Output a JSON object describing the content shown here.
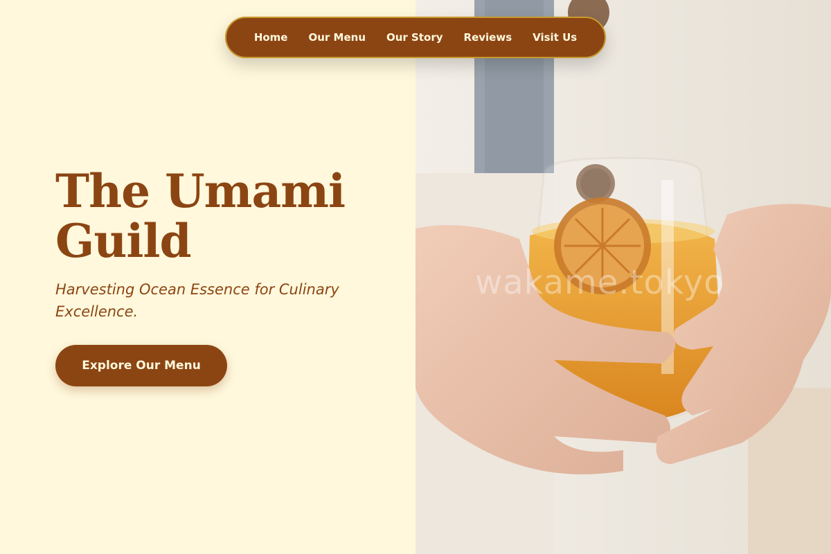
{
  "nav": {
    "items": [
      {
        "label": "Home"
      },
      {
        "label": "Our Menu"
      },
      {
        "label": "Our Story"
      },
      {
        "label": "Reviews"
      },
      {
        "label": "Visit Us"
      }
    ]
  },
  "hero": {
    "title": "The Umami Guild",
    "subtitle": "Harvesting Ocean Essence for Culinary Excellence.",
    "cta_label": "Explore Our Menu"
  },
  "photo": {
    "watermark": "wakame.tokyo"
  },
  "colors": {
    "brand": "#8b4513",
    "background": "#fff8dc",
    "nav_border": "#c99a2e"
  }
}
